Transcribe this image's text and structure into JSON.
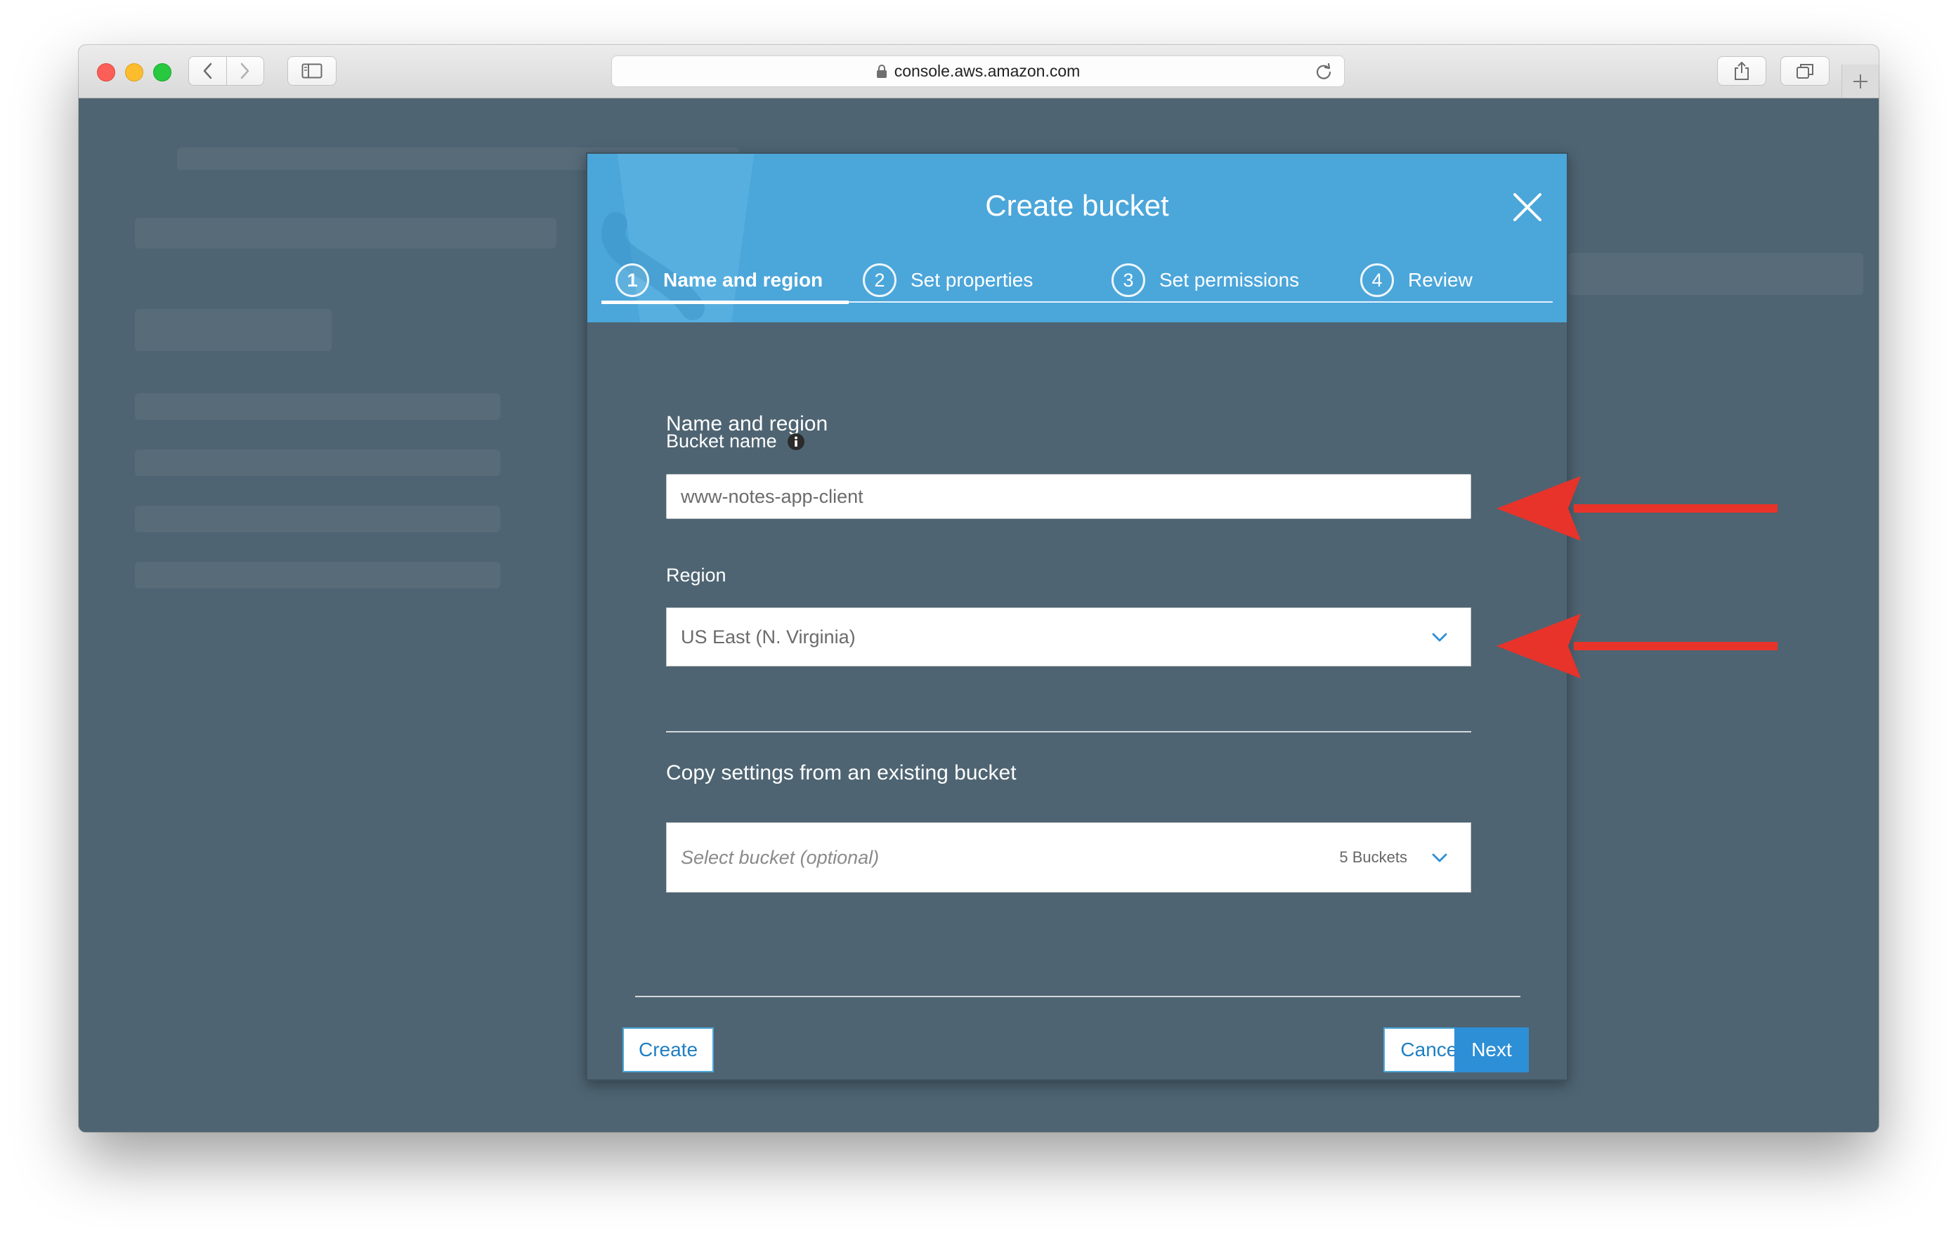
{
  "browser": {
    "url": "console.aws.amazon.com"
  },
  "modal": {
    "title": "Create bucket",
    "steps": [
      {
        "number": "1",
        "label": "Name and region"
      },
      {
        "number": "2",
        "label": "Set properties"
      },
      {
        "number": "3",
        "label": "Set permissions"
      },
      {
        "number": "4",
        "label": "Review"
      }
    ],
    "section_title": "Name and region",
    "bucket_name_label": "Bucket name",
    "bucket_name_value": "www-notes-app-client",
    "region_label": "Region",
    "region_value": "US East (N. Virginia)",
    "copy_settings_title": "Copy settings from an existing bucket",
    "copy_select_placeholder": "Select bucket (optional)",
    "copy_select_count": "5 Buckets",
    "buttons": {
      "create": "Create",
      "cancel": "Cancel",
      "next": "Next"
    }
  },
  "colors": {
    "header_blue": "#4ba6da",
    "overlay": "#4e6472",
    "primary_button": "#2d8fd6",
    "annotation_arrow": "#e8332a"
  },
  "icons": [
    "lock-icon",
    "reload-icon",
    "close-icon",
    "info-icon",
    "chevron-down-icon",
    "arrow-left-icon"
  ]
}
